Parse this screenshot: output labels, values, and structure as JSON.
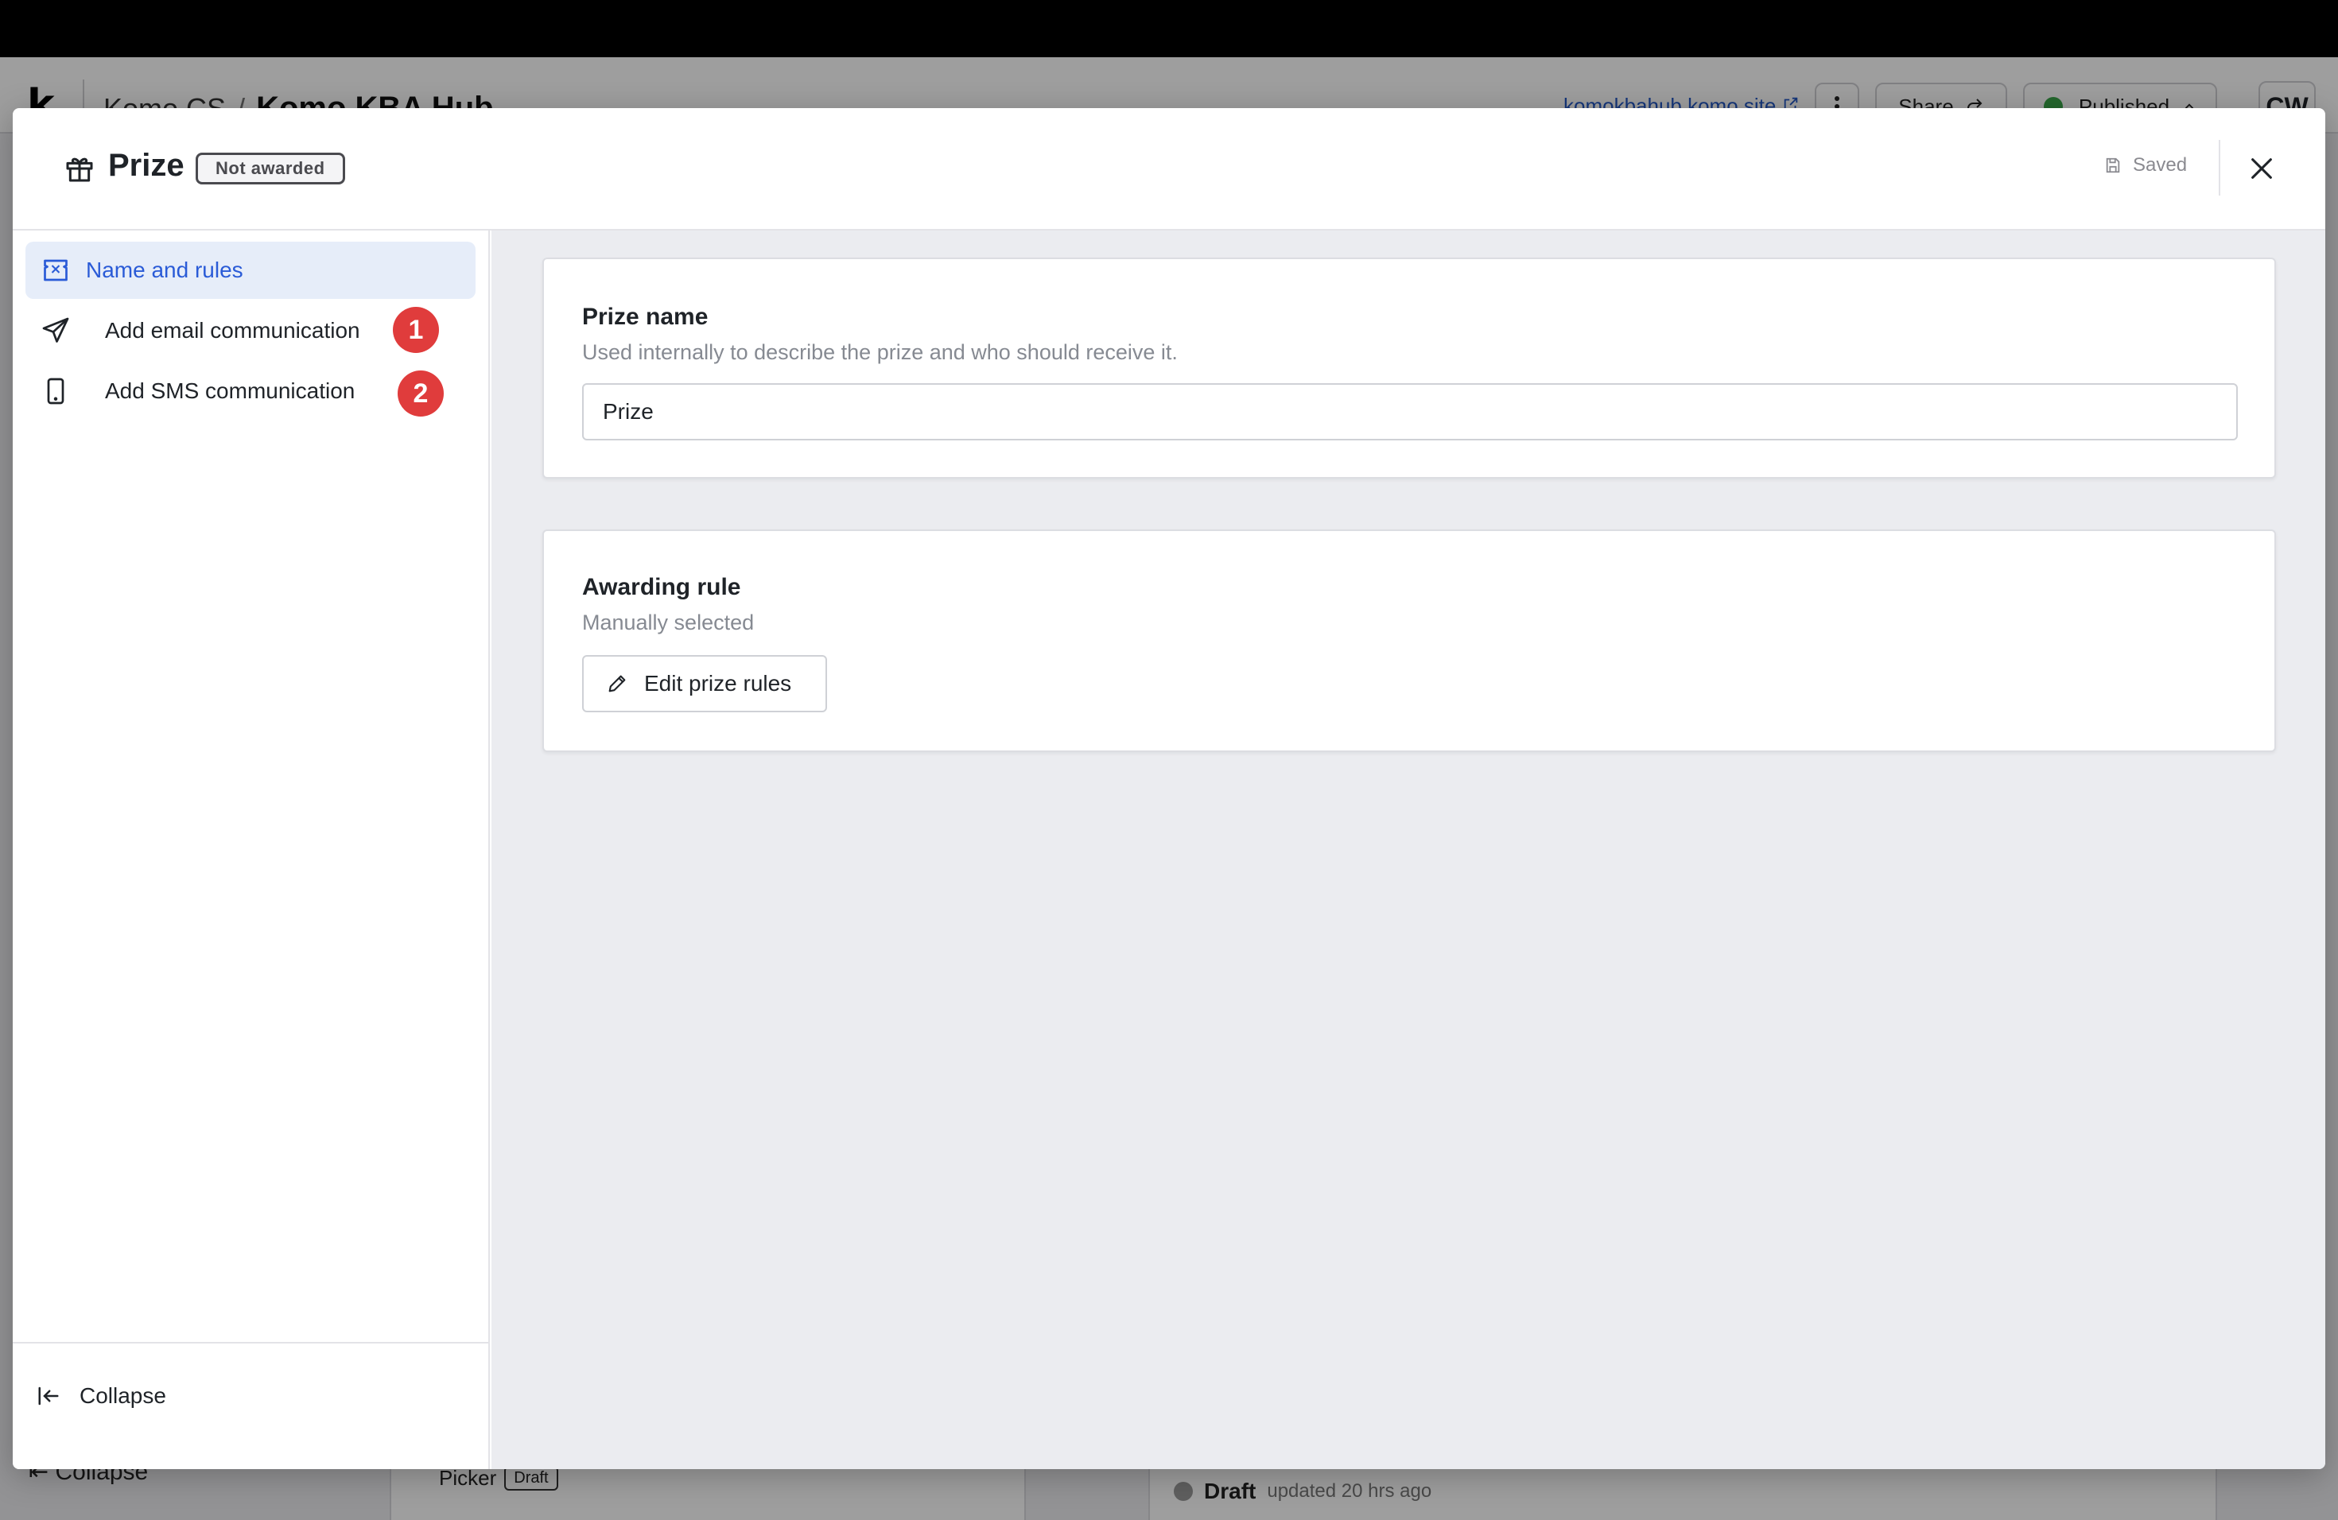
{
  "background_app": {
    "org": "Komo CS",
    "separator": "/",
    "hub_name": "Komo KBA Hub",
    "site_link": "komokbahub.komo.site",
    "share_label": "Share",
    "publish_status": "Published",
    "avatar_initials": "CW",
    "collapse_label": "Collapse",
    "picker_label": "Picker",
    "picker_badge": "Draft",
    "draft_label": "Draft",
    "draft_updated": "updated 20 hrs ago"
  },
  "modal": {
    "title": "Prize",
    "status_badge": "Not awarded",
    "saved_label": "Saved"
  },
  "sidebar": {
    "items": [
      {
        "label": "Name and rules",
        "icon": "ticket-icon",
        "active": true
      },
      {
        "label": "Add email communication",
        "icon": "send-icon",
        "badge": "1"
      },
      {
        "label": "Add SMS communication",
        "icon": "phone-icon",
        "badge": "2"
      }
    ],
    "collapse_label": "Collapse"
  },
  "prize_name_card": {
    "title": "Prize name",
    "subtitle": "Used internally to describe the prize and who should receive it.",
    "input_value": "Prize"
  },
  "awarding_rule_card": {
    "title": "Awarding rule",
    "subtitle": "Manually selected",
    "button_label": "Edit prize rules"
  },
  "colors": {
    "accent": "#2a5bd7",
    "active_bg": "#e6edf9",
    "badge_red": "#e03c3c",
    "content_bg": "#ebecf0"
  }
}
